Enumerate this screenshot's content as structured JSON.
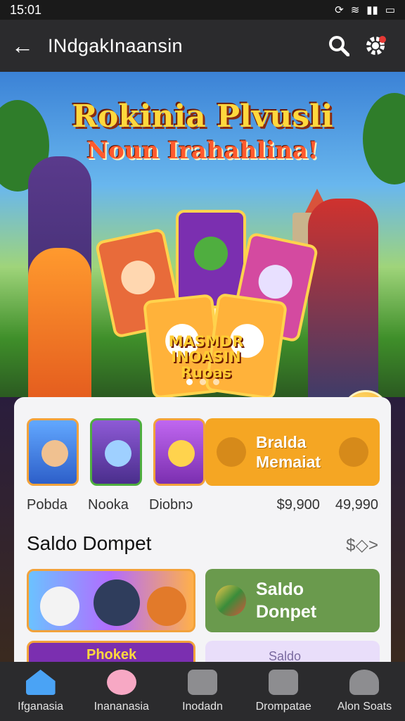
{
  "status_bar": {
    "time": "15:01",
    "icons": [
      "sync-icon",
      "wifi-icon",
      "signal-icon",
      "battery-icon"
    ]
  },
  "app_bar": {
    "title": "INdgakInaansin",
    "back_icon": "arrow-left-icon",
    "search_icon": "search-icon",
    "settings_icon": "gear-icon"
  },
  "banner": {
    "title": "Rokinia Plvusli",
    "subtitle": "Noun Irahahlina!",
    "card_label": "MASMDR INOASIN Ruoas",
    "dots": 3,
    "active_dot": 1
  },
  "games": {
    "items": [
      {
        "name": "Pobda",
        "color": "#3b7ee0"
      },
      {
        "name": "Nooka",
        "color": "#6b47b8"
      },
      {
        "name": "Diobnɔ",
        "color": "#a24bd6"
      }
    ],
    "wallet_button": {
      "label_line1": "Bralda",
      "label_line2": "Memaiat"
    },
    "prices": [
      "$9,900",
      "49,990"
    ]
  },
  "section": {
    "title": "Saldo Dompet",
    "more": "$◇>"
  },
  "saldo_card": {
    "label_line1": "Saldo",
    "label_line2": "Donpet"
  },
  "second_row": {
    "left_label": "Phokek",
    "right_label": "Saldo"
  },
  "nav": {
    "items": [
      {
        "label": "Ifganasia",
        "icon": "home-icon",
        "active": true
      },
      {
        "label": "Inananasia",
        "icon": "piggy-bank-icon",
        "active": false
      },
      {
        "label": "Inodadn",
        "icon": "camera-icon",
        "active": false
      },
      {
        "label": "Drompatae",
        "icon": "wallet-icon",
        "active": false
      },
      {
        "label": "Alon Soats",
        "icon": "profile-icon",
        "active": false
      }
    ]
  },
  "colors": {
    "accent": "#f5a623",
    "green": "#6a9a4d",
    "nav_active": "#4aa3f5"
  }
}
